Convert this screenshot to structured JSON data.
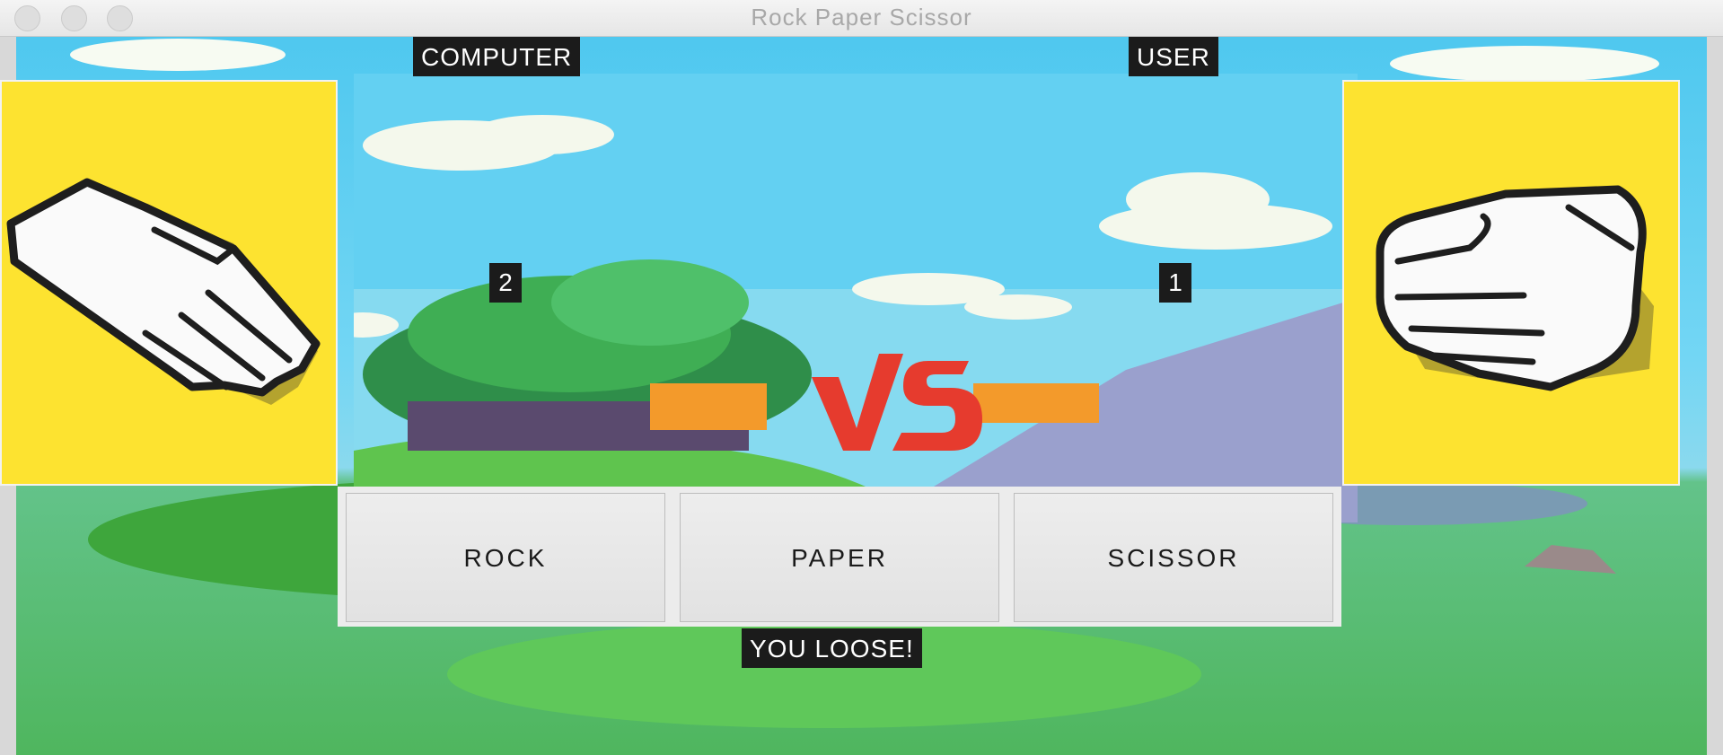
{
  "window": {
    "title": "Rock Paper Scissor"
  },
  "computer": {
    "label": "COMPUTER",
    "score": "2",
    "hand": "paper"
  },
  "user": {
    "label": "USER",
    "score": "1",
    "hand": "rock"
  },
  "buttons": {
    "rock": "ROCK",
    "paper": "PAPER",
    "scissor": "SCISSOR"
  },
  "result": "YOU LOOSE!",
  "colors": {
    "panel": "#fde330",
    "label_bg": "#1b1b1b",
    "sky": "#4fc8ef",
    "grass": "#4fb65e"
  }
}
